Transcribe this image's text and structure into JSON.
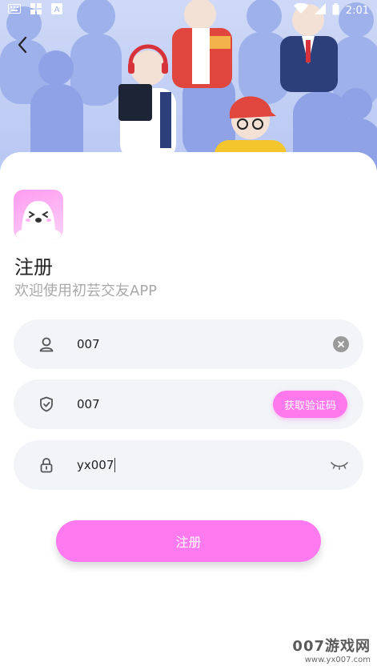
{
  "status_bar": {
    "time": "2:01",
    "icons": [
      "keyboard-icon",
      "grid-apps-icon",
      "font-a-icon",
      "wifi-icon",
      "signal-icon",
      "battery-icon"
    ]
  },
  "header": {
    "back_icon": "chevron-left-icon",
    "illustration": "crowd-people-illustration"
  },
  "app": {
    "logo_icon": "ghost-face-logo",
    "title": "注册",
    "subtitle": "欢迎使用初芸交友APP"
  },
  "form": {
    "username": {
      "icon": "user-icon",
      "value": "007",
      "clear_icon": "clear-icon"
    },
    "code": {
      "icon": "shield-check-icon",
      "value": "007",
      "button_label": "获取验证码"
    },
    "password": {
      "icon": "lock-icon",
      "value": "yx007",
      "eye_icon": "eye-closed-icon"
    },
    "submit_label": "注册"
  },
  "watermark": {
    "brand": "007游戏网",
    "url": "www.yx007.com"
  },
  "colors": {
    "accent": "#ff7aef",
    "field_bg": "#f2f4f8",
    "subtitle": "#a9a9a9",
    "hero_bg": "#bccaf3"
  }
}
